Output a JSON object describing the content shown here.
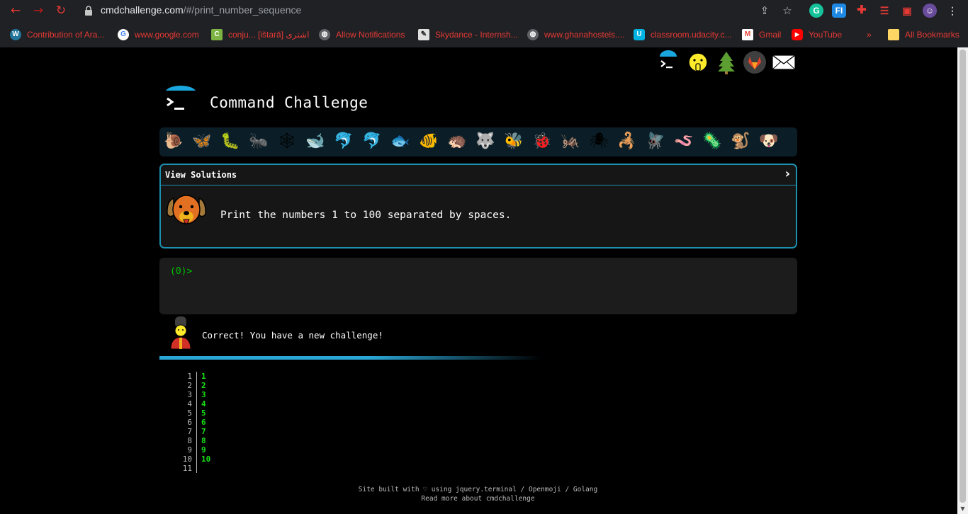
{
  "browser": {
    "url_host": "cmdchallenge.com",
    "url_path": "/#/print_number_sequence",
    "bookmarks": [
      {
        "label": "Contribution of Ara...",
        "icon": "wordpress-icon"
      },
      {
        "label": "www.google.com",
        "icon": "google-icon"
      },
      {
        "label": "conju... [ištarā] اشترى",
        "icon": "site-icon"
      },
      {
        "label": "Allow Notifications",
        "icon": "globe-icon"
      },
      {
        "label": "Skydance - Internsh...",
        "icon": "pen-icon"
      },
      {
        "label": "www.ghanahostels....",
        "icon": "globe-icon"
      },
      {
        "label": "classroom.udacity.c...",
        "icon": "udacity-icon"
      },
      {
        "label": "Gmail",
        "icon": "gmail-icon"
      },
      {
        "label": "YouTube",
        "icon": "youtube-icon"
      }
    ],
    "bookmarks_overflow": "»",
    "all_bookmarks": "All Bookmarks"
  },
  "page": {
    "title": "Command Challenge",
    "challenge": {
      "header": "View Solutions",
      "chevron": "›",
      "description": "Print the numbers 1 to 100 separated by spaces."
    },
    "terminal": {
      "prompt": "(0)>"
    },
    "result": {
      "message": "Correct! You have a new challenge!"
    },
    "output": {
      "line_numbers": [
        "1",
        "2",
        "3",
        "4",
        "5",
        "6",
        "7",
        "8",
        "9",
        "10",
        "11"
      ],
      "lines": [
        "1",
        "2",
        "3",
        "4",
        "5",
        "6",
        "7",
        "8",
        "9",
        "10",
        ""
      ]
    },
    "footer": {
      "line1": "Site built with ♡ using jquery.terminal / Openmoji / Golang",
      "line2": "Read more about cmdchallenge"
    }
  },
  "animals": [
    "🐌",
    "🦋",
    "🐛",
    "🐜",
    "🕸",
    "🐋",
    "🐬",
    "🐬",
    "🐟",
    "🐠",
    "🦔",
    "🐺",
    "🐝",
    "🐞",
    "🦗",
    "🕷",
    "🦂",
    "🪰",
    "🪱",
    "🦠",
    "🐒",
    "🐶"
  ],
  "colors": {
    "accent": "#1f8fb0",
    "prompt_green": "#00c400",
    "output_green": "#18e018",
    "bookmark_red": "#e53935"
  }
}
